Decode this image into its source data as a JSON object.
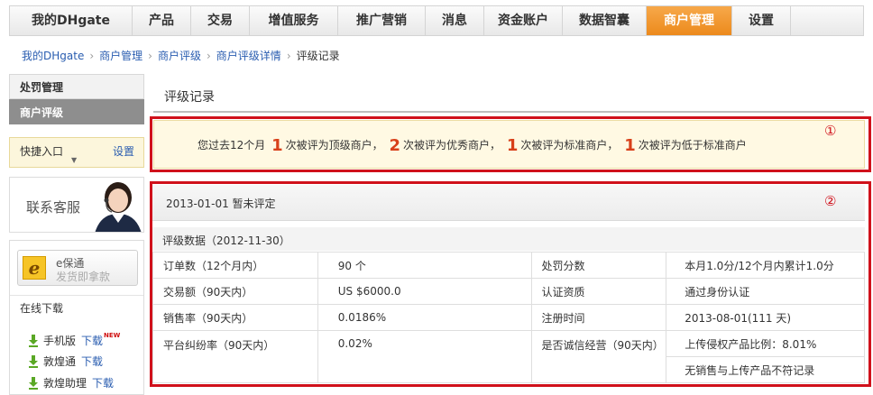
{
  "nav": {
    "items": [
      {
        "label": "我的DHgate",
        "active": false
      },
      {
        "label": "产品",
        "active": false
      },
      {
        "label": "交易",
        "active": false
      },
      {
        "label": "增值服务",
        "active": false
      },
      {
        "label": "推广营销",
        "active": false
      },
      {
        "label": "消息",
        "active": false
      },
      {
        "label": "资金账户",
        "active": false
      },
      {
        "label": "数据智囊",
        "active": false
      },
      {
        "label": "商户管理",
        "active": true
      },
      {
        "label": "设置",
        "active": false
      }
    ],
    "accent_color": "#ec8a1c"
  },
  "breadcrumb": {
    "items": [
      "我的DHgate",
      "商户管理",
      "商户评级",
      "商户评级详情"
    ],
    "current": "评级记录",
    "separator": "›"
  },
  "sidebar": {
    "menu": [
      {
        "label": "处罚管理",
        "active": false
      },
      {
        "label": "商户评级",
        "active": true
      }
    ],
    "quick": {
      "title": "快捷入口",
      "setting": "设置"
    },
    "service": {
      "label": "联系客服"
    },
    "ebao": {
      "name": "e保通",
      "subtitle": "发货即拿款"
    },
    "download": {
      "title": "在线下载",
      "link_label": "下载",
      "new_badge": "NEW",
      "items": [
        {
          "label": "手机版",
          "is_new": true
        },
        {
          "label": "敦煌通",
          "is_new": false
        },
        {
          "label": "敦煌助理",
          "is_new": false
        }
      ]
    }
  },
  "main": {
    "title": "评级记录",
    "annotation_1": "①",
    "annotation_2": "②",
    "frame_color": "#d0111b",
    "summary": {
      "prefix": "您过去12个月",
      "n1": "1",
      "t1": "次被评为顶级商户，",
      "n2": "2",
      "t2": "次被评为优秀商户，",
      "n3": "1",
      "t3": "次被评为标准商户，",
      "n4": "1",
      "t4": "次被评为低于标准商户"
    },
    "record": {
      "header": "2013-01-01 暂未评定",
      "subheader": "评级数据（2012-11-30）",
      "rows": [
        {
          "l1": "订单数（12个月内）",
          "v1": "90 个",
          "l2": "处罚分数",
          "v2": "本月1.0分/12个月内累计1.0分"
        },
        {
          "l1": "交易额（90天内）",
          "v1": "US $6000.0",
          "l2": "认证资质",
          "v2": "通过身份认证"
        },
        {
          "l1": "销售率（90天内）",
          "v1": "0.0186%",
          "l2": "注册时间",
          "v2": "2013-08-01(111 天)"
        },
        {
          "l1": "平台纠纷率（90天内）",
          "v1": "0.02%",
          "l2": "是否诚信经营（90天内）",
          "v2": "上传侵权产品比例：8.01%",
          "v2b": "无销售与上传产品不符记录"
        }
      ]
    }
  }
}
